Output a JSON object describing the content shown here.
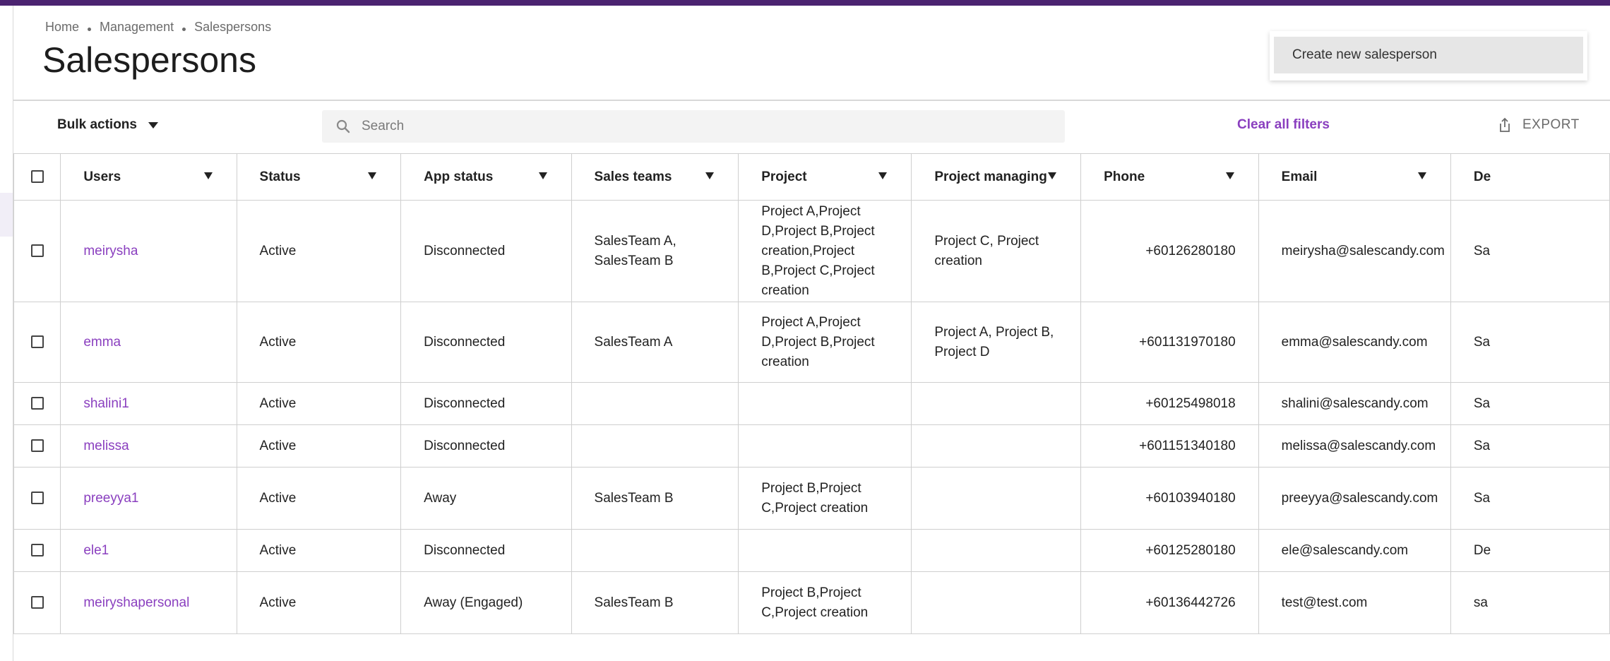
{
  "breadcrumb": [
    "Home",
    "Management",
    "Salespersons"
  ],
  "page_title": "Salespersons",
  "create_menu_item": "Create new salesperson",
  "toolbar": {
    "bulk_actions": "Bulk actions",
    "search_placeholder": "Search",
    "clear_filters": "Clear all filters",
    "export": "EXPORT"
  },
  "colors": {
    "accent": "#8a3fbf",
    "topbar": "#4b2370"
  },
  "table": {
    "columns": [
      "Users",
      "Status",
      "App status",
      "Sales teams",
      "Project",
      "Project managing",
      "Phone",
      "Email",
      "De"
    ],
    "rows": [
      {
        "user": "meirysha",
        "status": "Active",
        "app_status": "Disconnected",
        "sales_teams": "SalesTeam A, SalesTeam B",
        "project": "Project A,Project D,Project B,Project creation,Project B,Project C,Project creation",
        "project_managing": "Project C, Project creation",
        "phone": "+60126280180",
        "email": "meirysha@salescandy.com",
        "extra": "Sa"
      },
      {
        "user": "emma",
        "status": "Active",
        "app_status": "Disconnected",
        "sales_teams": "SalesTeam A",
        "project": "Project A,Project D,Project B,Project creation",
        "project_managing": "Project A, Project B, Project D",
        "phone": "+601131970180",
        "email": "emma@salescandy.com",
        "extra": "Sa"
      },
      {
        "user": "shalini1",
        "status": "Active",
        "app_status": "Disconnected",
        "sales_teams": "",
        "project": "",
        "project_managing": "",
        "phone": "+60125498018",
        "email": "shalini@salescandy.com",
        "extra": "Sa"
      },
      {
        "user": "melissa",
        "status": "Active",
        "app_status": "Disconnected",
        "sales_teams": "",
        "project": "",
        "project_managing": "",
        "phone": "+601151340180",
        "email": "melissa@salescandy.com",
        "extra": "Sa"
      },
      {
        "user": "preeyya1",
        "status": "Active",
        "app_status": "Away",
        "sales_teams": "SalesTeam B",
        "project": "Project B,Project C,Project creation",
        "project_managing": "",
        "phone": "+60103940180",
        "email": "preeyya@salescandy.com",
        "extra": "Sa"
      },
      {
        "user": "ele1",
        "status": "Active",
        "app_status": "Disconnected",
        "sales_teams": "",
        "project": "",
        "project_managing": "",
        "phone": "+60125280180",
        "email": "ele@salescandy.com",
        "extra": "De"
      },
      {
        "user": "meiryshapersonal",
        "status": "Active",
        "app_status": "Away (Engaged)",
        "sales_teams": "SalesTeam B",
        "project": "Project B,Project C,Project creation",
        "project_managing": "",
        "phone": "+60136442726",
        "email": "test@test.com",
        "extra": "sa"
      }
    ]
  }
}
